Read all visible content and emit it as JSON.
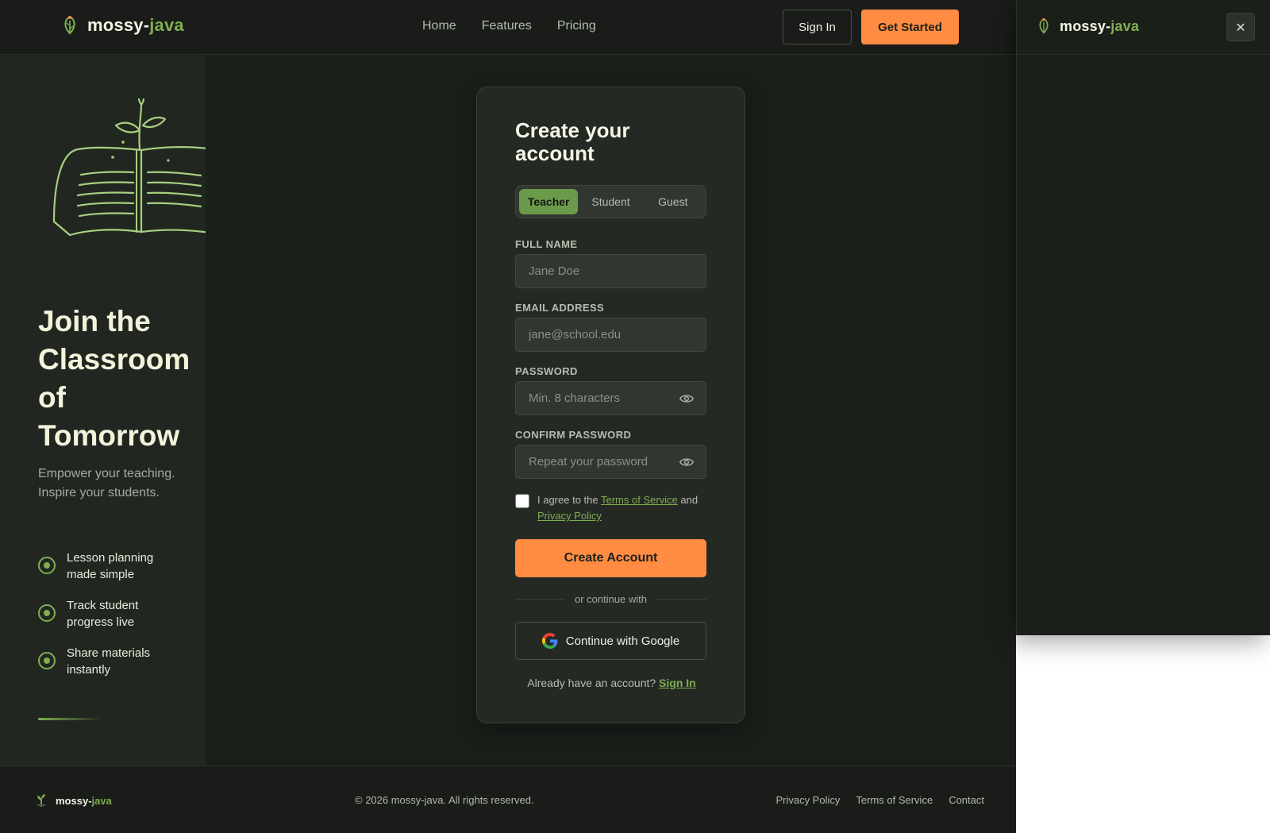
{
  "brand": {
    "name_main": "mossy-",
    "name_accent": "java"
  },
  "nav": {
    "items": [
      "Home",
      "Features",
      "Pricing"
    ]
  },
  "header": {
    "signin_label": "Sign In",
    "get_started_label": "Get Started"
  },
  "hero": {
    "title": "Join the Classroom of Tomorrow",
    "subtitle": "Empower your teaching. Inspire your students.",
    "features": [
      "Lesson planning made simple",
      "Track student progress live",
      "Share materials instantly"
    ]
  },
  "form": {
    "title": "Create your account",
    "roles": [
      "Teacher",
      "Student",
      "Guest"
    ],
    "selected_role": "Teacher",
    "full_name": {
      "label": "FULL NAME",
      "placeholder": "Jane Doe",
      "value": ""
    },
    "email": {
      "label": "EMAIL ADDRESS",
      "placeholder": "jane@school.edu",
      "value": ""
    },
    "password": {
      "label": "PASSWORD",
      "placeholder": "Min. 8 characters",
      "value": ""
    },
    "confirm_password": {
      "label": "CONFIRM PASSWORD",
      "placeholder": "Repeat your password",
      "value": ""
    },
    "agree": {
      "prefix": "I agree to the ",
      "terms": "Terms of Service",
      "middle": " and ",
      "privacy": "Privacy Policy",
      "checked": false
    },
    "submit_label": "Create Account",
    "divider_text": "or continue with",
    "google_label": "Continue with Google",
    "signin_prompt": "Already have an account? ",
    "signin_link": "Sign In"
  },
  "footer": {
    "copyright": "© 2026 mossy-java. All rights reserved.",
    "links": [
      "Privacy Policy",
      "Terms of Service",
      "Contact"
    ]
  },
  "drawer": {
    "close_label": "✕"
  },
  "colors": {
    "accent_orange": "#ff8c42",
    "accent_green": "#7fae52",
    "background": "#1b1f1a",
    "card": "#252924"
  },
  "icons": {
    "brand": "leaf-icon",
    "password_toggle": "eye-icon",
    "google": "google-icon",
    "feature_bullet": "target-dot-icon",
    "close": "close-icon"
  }
}
